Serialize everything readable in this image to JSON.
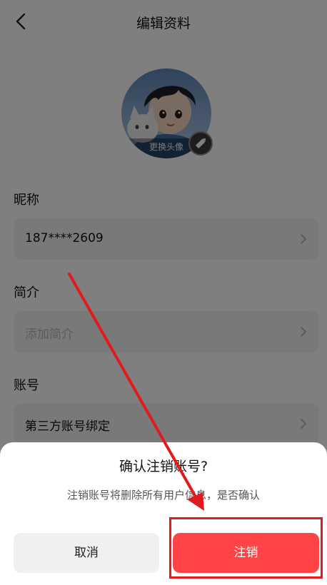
{
  "nav": {
    "title": "编辑资料"
  },
  "avatar": {
    "caption": "更换头像"
  },
  "sections": {
    "nickname_label": "昵称",
    "nickname_value": "187****2609",
    "bio_label": "简介",
    "bio_placeholder": "添加简介",
    "account_label": "账号",
    "account_binding": "第三方账号绑定"
  },
  "dialog": {
    "title": "确认注销账号?",
    "message": "注销账号将删除所有用户信息，是否确认",
    "cancel_label": "取消",
    "confirm_label": "注销"
  },
  "icons": {
    "back": "back-arrow-icon",
    "chevron": "chevron-right-icon",
    "edit": "pencil-icon"
  },
  "colors": {
    "confirm": "#ff4346",
    "annotation": "#e11b1b",
    "scrim": "rgba(0,0,0,0.5)"
  }
}
